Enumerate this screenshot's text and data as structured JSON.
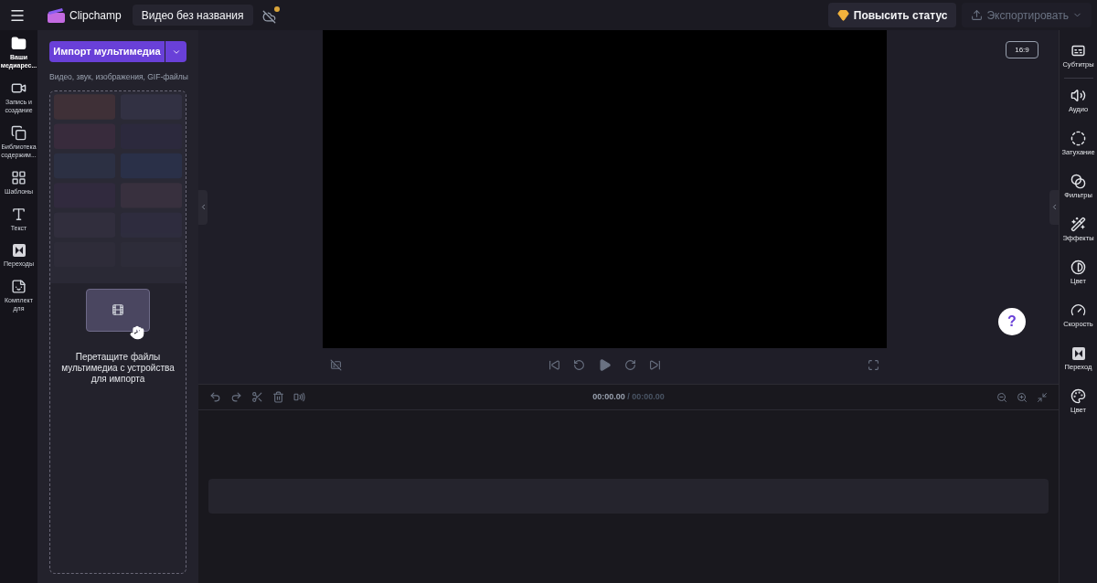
{
  "top_bar": {
    "app_name": "Clipchamp",
    "project_title": "Видео без названия",
    "upgrade_button": "Повысить статус",
    "export_button": {
      "label": "Экспортировать",
      "disabled": true
    }
  },
  "left_rail": [
    {
      "label": "Ваши медиарес...",
      "selected": true
    },
    {
      "label": "Запись и создание",
      "selected": false
    },
    {
      "label": "Библиотека содержим...",
      "selected": false
    },
    {
      "label": "Шаблоны",
      "selected": false
    },
    {
      "label": "Текст",
      "selected": false
    },
    {
      "label": "Переходы",
      "selected": false
    },
    {
      "label": "Комплект для",
      "selected": false
    }
  ],
  "media_panel": {
    "import_button": "Импорт мультимедиа",
    "hint": "Видео, звук, изображения, GIF-файлы",
    "drop_text": "Перетащите файлы мультимедиа с устройства для импорта"
  },
  "preview": {
    "aspect_ratio": "16:9"
  },
  "timeline": {
    "current_time": "00:00.00",
    "total_time": "/ 00:00.00"
  },
  "right_rail": [
    {
      "label": "Субтитры"
    },
    {
      "label": "Аудио"
    },
    {
      "label": "Затухание"
    },
    {
      "label": "Фильтры"
    },
    {
      "label": "Эффекты"
    },
    {
      "label": "Цвет"
    },
    {
      "label": "Скорость"
    },
    {
      "label": "Переход"
    },
    {
      "label": "Цвет"
    }
  ],
  "help_button": "?"
}
